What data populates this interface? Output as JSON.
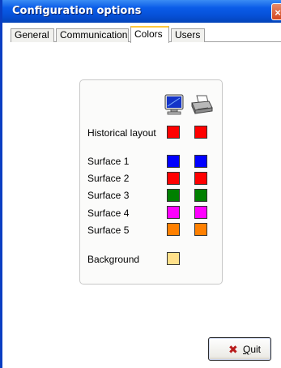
{
  "window": {
    "title": "Configuration options",
    "close_glyph": "×"
  },
  "tabs": [
    {
      "label": "General",
      "active": false
    },
    {
      "label": "Communication",
      "active": false
    },
    {
      "label": "Colors",
      "active": true
    },
    {
      "label": "Users",
      "active": false
    }
  ],
  "columns": [
    {
      "icon": "monitor-icon"
    },
    {
      "icon": "printer-icon"
    }
  ],
  "rows": [
    {
      "label": "Historical layout",
      "screen_color": "#ff0000",
      "print_color": "#ff0000"
    },
    {
      "label": "Surface 1",
      "screen_color": "#0000ff",
      "print_color": "#0000ff"
    },
    {
      "label": "Surface 2",
      "screen_color": "#ff0000",
      "print_color": "#ff0000"
    },
    {
      "label": "Surface 3",
      "screen_color": "#008000",
      "print_color": "#008000"
    },
    {
      "label": "Surface 4",
      "screen_color": "#ff00ff",
      "print_color": "#ff00ff"
    },
    {
      "label": "Surface 5",
      "screen_color": "#ff8000",
      "print_color": "#ff8000"
    },
    {
      "label": "Background",
      "screen_color": "#ffe08a",
      "print_color": null
    }
  ],
  "quit_button": {
    "icon": "x-icon",
    "label_prefix": "",
    "label_accel": "Q",
    "label_rest": "uit"
  }
}
